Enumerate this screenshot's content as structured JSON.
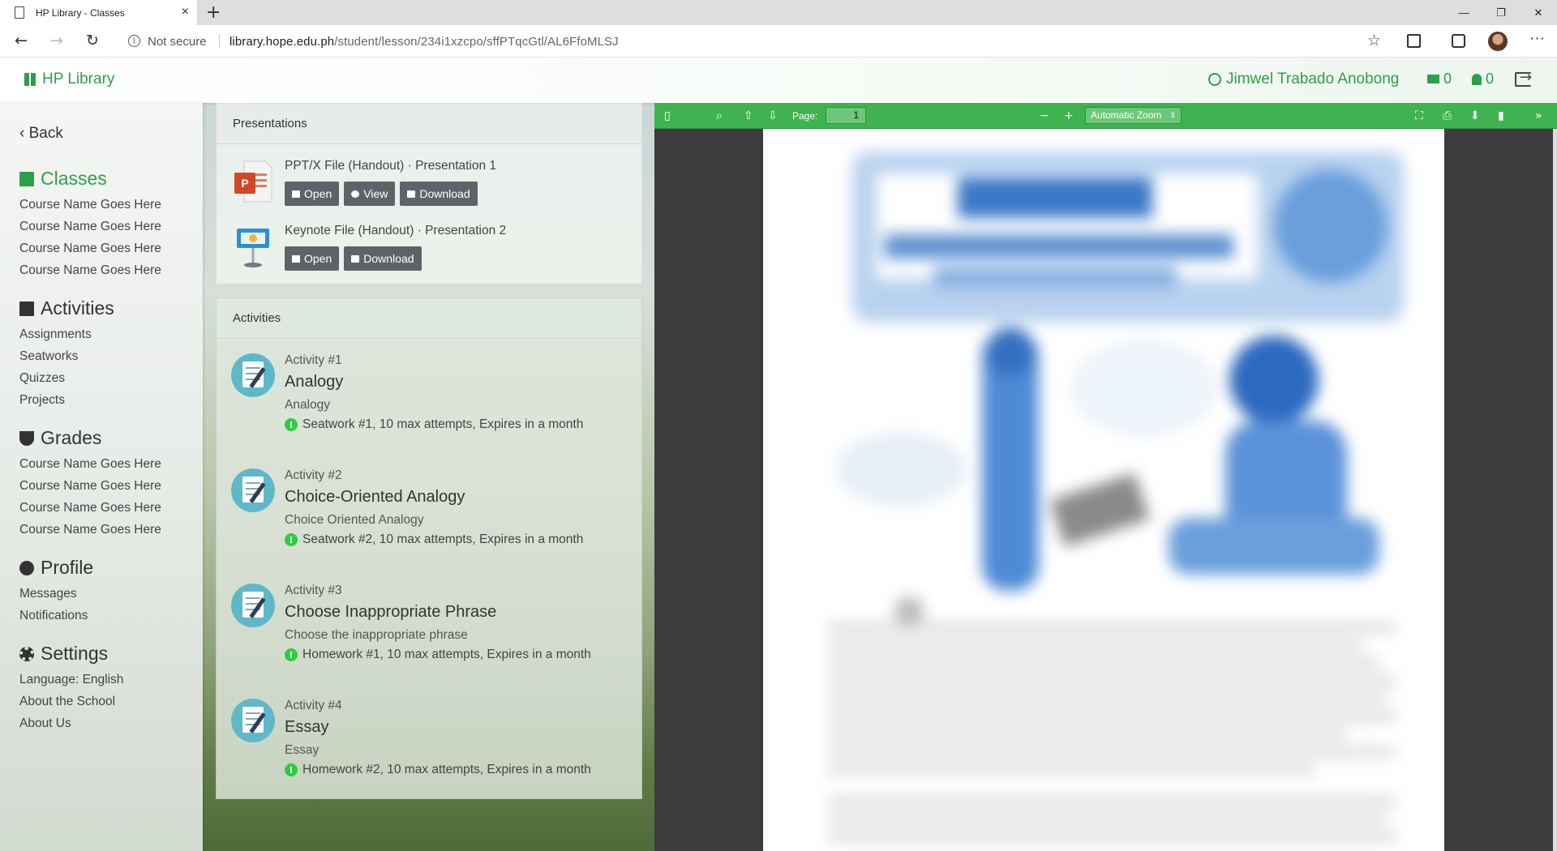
{
  "browser": {
    "tab_title": "HP Library - Classes",
    "security": "Not secure",
    "url_host": "library.hope.edu.ph",
    "url_path": "/student/lesson/234i1xzcpo/sffPTqcGtl/AL6FfoMLSJ"
  },
  "header": {
    "brand": "HP Library",
    "user_name": "Jimwel Trabado Anobong",
    "messages_count": "0",
    "notifications_count": "0"
  },
  "sidebar": {
    "back": "Back",
    "classes": {
      "title": "Classes",
      "items": [
        "Course Name Goes Here",
        "Course Name Goes Here",
        "Course Name Goes Here",
        "Course Name Goes Here"
      ]
    },
    "activities": {
      "title": "Activities",
      "items": [
        "Assignments",
        "Seatworks",
        "Quizzes",
        "Projects"
      ]
    },
    "grades": {
      "title": "Grades",
      "items": [
        "Course Name Goes Here",
        "Course Name Goes Here",
        "Course Name Goes Here",
        "Course Name Goes Here"
      ]
    },
    "profile": {
      "title": "Profile",
      "items": [
        "Messages",
        "Notifications"
      ]
    },
    "settings": {
      "title": "Settings",
      "items": [
        "Language: English",
        "About the School",
        "About Us"
      ]
    }
  },
  "presentations": {
    "heading": "Presentations",
    "items": [
      {
        "title": "PPT/X File (Handout) · Presentation 1",
        "buttons": [
          "Open",
          "View",
          "Download"
        ]
      },
      {
        "title": "Keynote File (Handout) · Presentation 2",
        "buttons": [
          "Open",
          "Download"
        ]
      }
    ]
  },
  "activities": {
    "heading": "Activities",
    "items": [
      {
        "number": "Activity #1",
        "title": "Analogy",
        "subtitle": "Analogy",
        "meta": "Seatwork #1, 10 max attempts, Expires in a month"
      },
      {
        "number": "Activity #2",
        "title": "Choice-Oriented Analogy",
        "subtitle": "Choice Oriented Analogy",
        "meta": "Seatwork #2, 10 max attempts, Expires in a month"
      },
      {
        "number": "Activity #3",
        "title": "Choose Inappropriate Phrase",
        "subtitle": "Choose the inappropriate phrase",
        "meta": "Homework #1, 10 max attempts, Expires in a month"
      },
      {
        "number": "Activity #4",
        "title": "Essay",
        "subtitle": "Essay",
        "meta": "Homework #2, 10 max attempts, Expires in a month"
      }
    ]
  },
  "viewer": {
    "page_label": "Page:",
    "page_number": "1",
    "zoom": "Automatic Zoom"
  },
  "colors": {
    "brand_green": "#2e9e4a",
    "viewer_toolbar": "#3fb34f",
    "button_gray": "#5d6468",
    "status_green": "#2ecc40"
  }
}
